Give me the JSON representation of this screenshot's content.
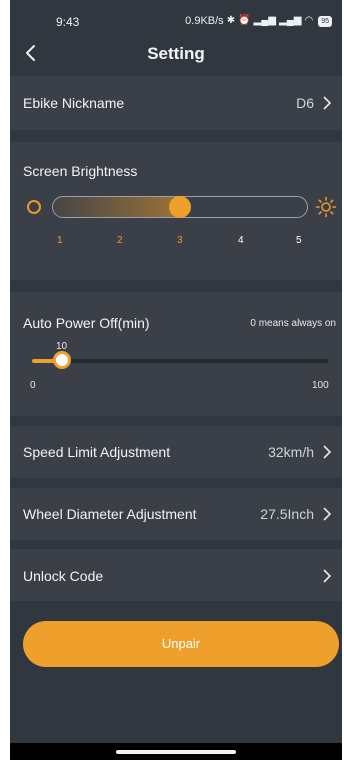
{
  "status_bar": {
    "time": "9:43",
    "net_speed": "0.9KB/s",
    "battery": "95"
  },
  "header": {
    "title": "Setting"
  },
  "rows": {
    "nickname": {
      "label": "Ebike Nickname",
      "value": "D6"
    },
    "speed_limit": {
      "label": "Speed Limit Adjustment",
      "value": "32km/h"
    },
    "wheel": {
      "label": "Wheel Diameter Adjustment",
      "value": "27.5Inch"
    },
    "unlock": {
      "label": "Unlock Code"
    }
  },
  "brightness": {
    "label": "Screen Brightness",
    "levels": [
      "1",
      "2",
      "3",
      "4",
      "5"
    ],
    "selected": 3
  },
  "auto_power": {
    "label": "Auto Power Off(min)",
    "note": "0 means always on",
    "value": "10",
    "min": "0",
    "max": "100"
  },
  "actions": {
    "unpair": "Unpair"
  },
  "colors": {
    "accent": "#efa02c",
    "background": "#31373f",
    "card": "#3b4048"
  }
}
